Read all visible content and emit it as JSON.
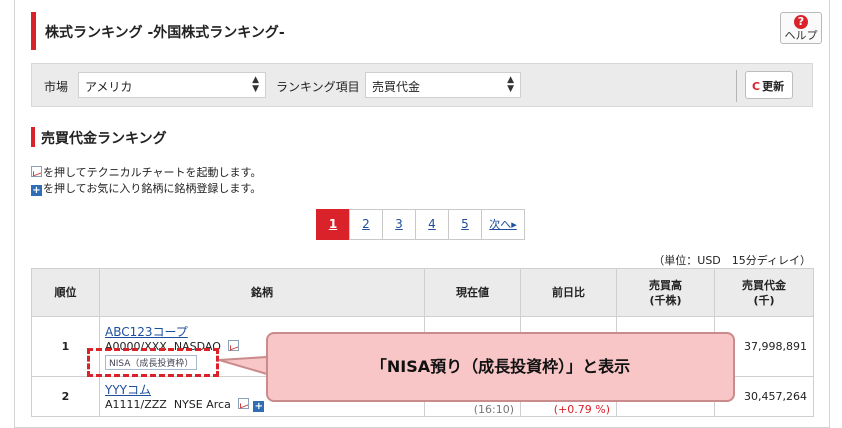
{
  "header": {
    "title": "株式ランキング -外国株式ランキング-",
    "help_label": "ヘルプ",
    "help_mark": "?"
  },
  "filter": {
    "market_label": "市場",
    "market_value": "アメリカ",
    "ranking_label": "ランキング項目",
    "ranking_value": "売買代金",
    "refresh_icon": "C",
    "refresh_label": "更新"
  },
  "section": {
    "title": "売買代金ランキング",
    "note_chart": "を押してテクニカルチャートを起動します。",
    "note_fav": "を押してお気に入り銘柄に銘柄登録します。"
  },
  "pagination": {
    "pages": [
      "1",
      "2",
      "3",
      "4",
      "5"
    ],
    "active": "1",
    "next_label": "次へ▸"
  },
  "unit_note": "（単位：USD　15分ディレイ）",
  "table": {
    "headers": {
      "rank": "順位",
      "name": "銘柄",
      "price": "現在値",
      "change": "前日比",
      "volume_l1": "売買高",
      "volume_l2": "(千株)",
      "value_l1": "売買代金",
      "value_l2": "(千)"
    },
    "rows": [
      {
        "rank": "1",
        "name": "ABC123コープ",
        "code": "A0000/XXX",
        "market": "NASDAQ",
        "nisa": "NISA（成長投資枠）",
        "value": "37,998,891"
      },
      {
        "rank": "2",
        "name": "YYYコム",
        "code": "A1111/ZZZ",
        "market": "NYSE Arca",
        "price": "(16:10)",
        "change": "(+0.79 %)",
        "value": "30,457,264"
      }
    ]
  },
  "callout": {
    "text": "「NISA預り（成長投資枠）」と表示"
  },
  "colors": {
    "accent": "#d9222a",
    "callout_bg": "#f8c6c6",
    "link": "#1f4e9c"
  }
}
